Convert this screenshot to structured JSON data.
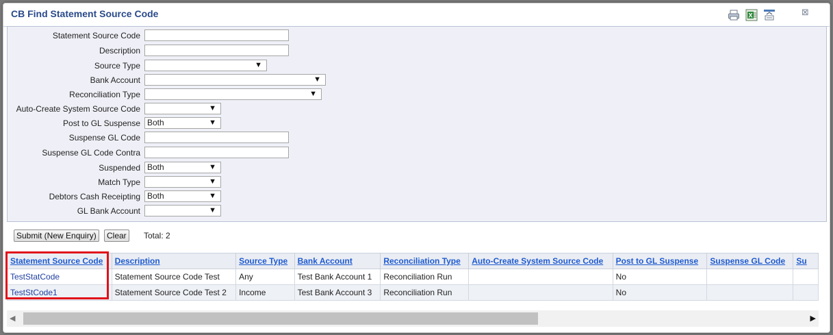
{
  "window": {
    "title": "CB Find Statement Source Code"
  },
  "toolbar": {
    "icons": [
      "print-icon",
      "excel-export-icon",
      "collapse-icon",
      "close-icon"
    ],
    "close_glyph": "⊠"
  },
  "form": {
    "fields": [
      {
        "label": "Statement Source Code",
        "type": "text",
        "value": ""
      },
      {
        "label": "Description",
        "type": "text",
        "value": ""
      },
      {
        "label": "Source Type",
        "type": "select",
        "value": ""
      },
      {
        "label": "Bank Account",
        "type": "select",
        "value": ""
      },
      {
        "label": "Reconciliation Type",
        "type": "select",
        "value": ""
      },
      {
        "label": "Auto-Create System Source Code",
        "type": "select",
        "value": ""
      },
      {
        "label": "Post to GL Suspense",
        "type": "select",
        "value": "Both"
      },
      {
        "label": "Suspense GL Code",
        "type": "text",
        "value": ""
      },
      {
        "label": "Suspense GL Code Contra",
        "type": "text",
        "value": ""
      },
      {
        "label": "Suspended",
        "type": "select",
        "value": "Both"
      },
      {
        "label": "Match Type",
        "type": "select",
        "value": ""
      },
      {
        "label": "Debtors Cash Receipting",
        "type": "select",
        "value": "Both"
      },
      {
        "label": "GL Bank Account",
        "type": "select",
        "value": ""
      }
    ]
  },
  "actions": {
    "submit_label": "Submit (New Enquiry)",
    "clear_label": "Clear",
    "total_text": "Total: 2"
  },
  "grid": {
    "columns": [
      "Statement Source Code",
      "Description",
      "Source Type",
      "Bank Account",
      "Reconciliation Type",
      "Auto-Create System Source Code",
      "Post to GL Suspense",
      "Suspense GL Code",
      "Su"
    ],
    "rows": [
      [
        "TestStatCode",
        "Statement Source Code Test",
        "Any",
        "Test Bank Account 1",
        "Reconciliation Run",
        "",
        "No",
        "",
        ""
      ],
      [
        "TestStCode1",
        "Statement Source Code Test 2",
        "Income",
        "Test Bank Account 3",
        "Reconciliation Run",
        "",
        "No",
        "",
        ""
      ]
    ]
  },
  "colors": {
    "title": "#2a4a8a",
    "link": "#1e5ad0",
    "highlight": "#e0101a",
    "form_bg": "#eff0f7"
  }
}
